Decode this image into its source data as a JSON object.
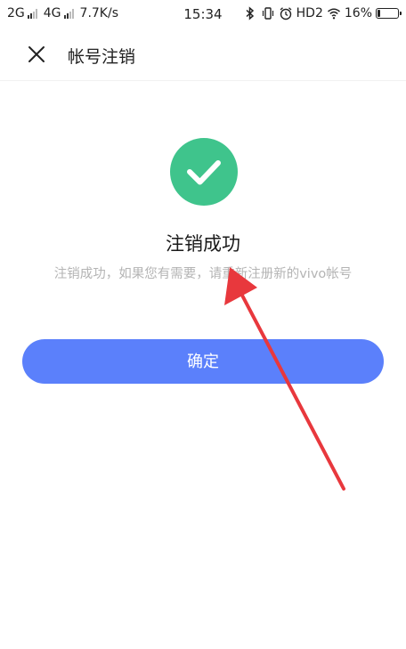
{
  "status_bar": {
    "net1": "2G",
    "net2": "4G",
    "speed": "7.7K/s",
    "time": "15:34",
    "hd_label": "HD2",
    "battery_text": "16%",
    "battery_level": 0.16
  },
  "header": {
    "close_icon": "close-icon",
    "title": "帐号注销"
  },
  "main": {
    "success_icon": "checkmark-icon",
    "success_color": "#3fc48c",
    "title": "注销成功",
    "description": "注销成功，如果您有需要，请重新注册新的vivo帐号",
    "confirm_label": "确定",
    "confirm_color": "#5b80fb"
  },
  "annotation": {
    "arrow_color": "#e8383d"
  }
}
